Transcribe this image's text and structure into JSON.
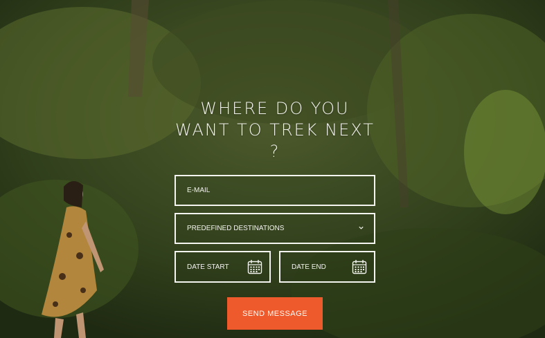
{
  "heading": "WHERE DO YOU WANT TO TREK NEXT ?",
  "form": {
    "email_placeholder": "E-MAIL",
    "destinations_selected": "PREDEFINED DESTINATIONS",
    "date_start_placeholder": "DATE START",
    "date_end_placeholder": "DATE END",
    "send_label": "SEND MESSAGE"
  },
  "icons": {
    "dropdown": "chevron-down-icon",
    "calendar": "calendar-icon"
  },
  "colors": {
    "accent": "#ee5a2b",
    "field_border": "#f4f4f0",
    "text": "#f3f3ee"
  }
}
